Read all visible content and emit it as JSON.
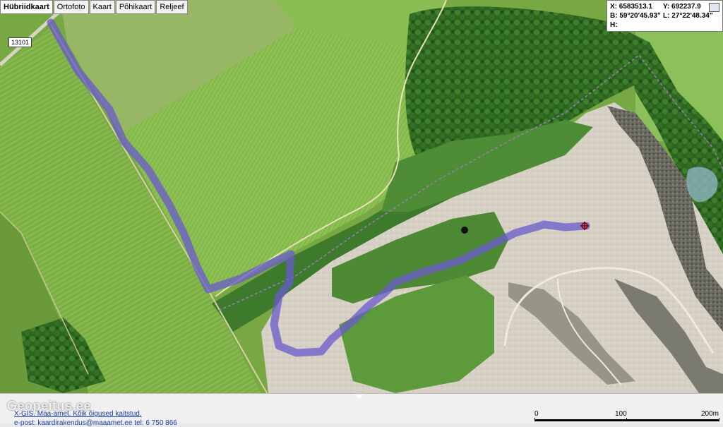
{
  "tabs": [
    {
      "label": "Hübriidkaart",
      "active": true
    },
    {
      "label": "Ortofoto",
      "active": false
    },
    {
      "label": "Kaart",
      "active": false
    },
    {
      "label": "Põhikaart",
      "active": false
    },
    {
      "label": "Reljeef",
      "active": false
    }
  ],
  "road_number": "13101",
  "coords": {
    "x": "X: 6583513.1",
    "y": "Y: 692237.9",
    "b": "B: 59°20'45.93\"",
    "l": "L: 27°22'48.34\"",
    "h": "H:"
  },
  "footer": {
    "watermark": "Geopeitus.ee",
    "copyright": "X-GIS. Maa-amet. Kõik õigused kaitstud.",
    "contact": "e-post: kaardirakendus@maaamet.ee tel: 6 750 866"
  },
  "scale": {
    "labels": [
      "0",
      "100",
      "200m"
    ]
  },
  "colors": {
    "track": "#6a5acd",
    "field_light": "#7fb04a",
    "field_dark": "#5f9a35",
    "forest": "#2f6b22",
    "quarry": "#d4cfc2"
  }
}
